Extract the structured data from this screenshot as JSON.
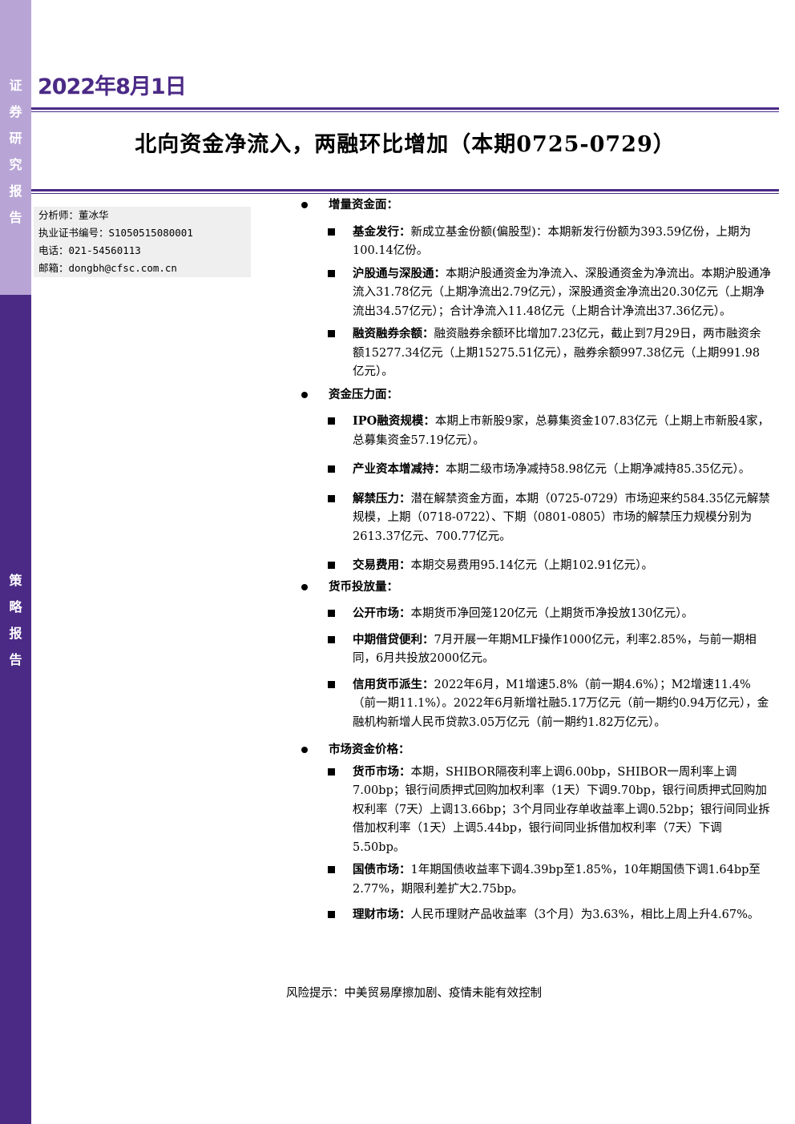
{
  "sidebar": {
    "top_label": [
      "证",
      "券",
      "研",
      "究",
      "报",
      "告"
    ],
    "bottom_label": [
      "策",
      "略",
      "报",
      "告"
    ]
  },
  "header": {
    "date": "2022年8月1日",
    "title": "北向资金净流入，两融环比增加（本期0725-0729）"
  },
  "analyst": {
    "name": "分析师：董冰华",
    "cert": "执业证书编号：S1050515080001",
    "phone": "电话：021-54560113",
    "email": "邮箱：dongbh@cfsc.com.cn"
  },
  "sections": [
    {
      "heading": "增量资金面：",
      "items": [
        {
          "label": "基金发行：",
          "text": "新成立基金份额(偏股型)：本期新发行份额为393.59亿份，上期为100.14亿份。"
        },
        {
          "label": "沪股通与深股通：",
          "text": "本期沪股通资金为净流入、深股通资金为净流出。本期沪股通净流入31.78亿元（上期净流出2.79亿元），深股通资金净流出20.30亿元（上期净流出34.57亿元）；合计净流入11.48亿元（上期合计净流出37.36亿元）。"
        },
        {
          "label": "融资融券余额：",
          "text": "融资融券余额环比增加7.23亿元，截止到7月29日，两市融资余额15277.34亿元（上期15275.51亿元），融券余额997.38亿元（上期991.98亿元）。"
        }
      ]
    },
    {
      "heading": "资金压力面：",
      "items": [
        {
          "label": "IPO融资规模：",
          "text": "本期上市新股9家，总募集资金107.83亿元（上期上市新股4家，总募集资金57.19亿元）。"
        },
        {
          "label": "产业资本增减持：",
          "text": "本期二级市场净减持58.98亿元（上期净减持85.35亿元）。"
        },
        {
          "label": "解禁压力：",
          "text": "潜在解禁资金方面，本期（0725-0729）市场迎来约584.35亿元解禁规模，上期（0718-0722）、下期（0801-0805）市场的解禁压力规模分别为2613.37亿元、700.77亿元。"
        },
        {
          "label": "交易费用：",
          "text": "本期交易费用95.14亿元（上期102.91亿元）。"
        }
      ]
    },
    {
      "heading": "货币投放量：",
      "items": [
        {
          "label": "公开市场：",
          "text": "本期货币净回笼120亿元（上期货币净投放130亿元）。"
        },
        {
          "label": "中期借贷便利：",
          "text": "7月开展一年期MLF操作1000亿元，利率2.85%，与前一期相同，6月共投放2000亿元。"
        },
        {
          "label": "信用货币派生：",
          "text": "2022年6月，M1增速5.8%（前一期4.6%）；M2增速11.4%（前一期11.1%）。2022年6月新增社融5.17万亿元（前一期约0.94万亿元），金融机构新增人民币贷款3.05万亿元（前一期约1.82万亿元）。"
        }
      ]
    },
    {
      "heading": "市场资金价格：",
      "items": [
        {
          "label": "货币市场：",
          "text": "本期，SHIBOR隔夜利率上调6.00bp，SHIBOR一周利率上调7.00bp；银行间质押式回购加权利率（1天）下调9.70bp，银行间质押式回购加权利率（7天）上调13.66bp；3个月同业存单收益率上调0.52bp；银行间同业拆借加权利率（1天）上调5.44bp，银行间同业拆借加权利率（7天）下调5.50bp。"
        },
        {
          "label": "国债市场：",
          "text": "1年期国债收益率下调4.39bp至1.85%，10年期国债下调1.64bp至2.77%，期限利差扩大2.75bp。"
        },
        {
          "label": "理财市场：",
          "text": "人民币理财产品收益率（3个月）为3.63%，相比上周上升4.67%。"
        }
      ]
    }
  ],
  "risk": "风险提示：中美贸易摩擦加剧、疫情未能有效控制"
}
